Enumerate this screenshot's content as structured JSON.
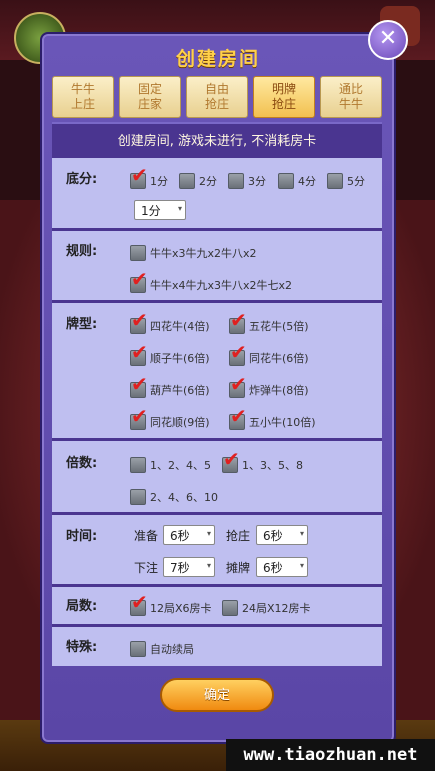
{
  "dialog": {
    "title": "创建房间",
    "close_icon": "close-icon",
    "tabs": [
      {
        "label": "牛牛\n上庄",
        "active": false
      },
      {
        "label": "固定\n庄家",
        "active": false
      },
      {
        "label": "自由\n抢庄",
        "active": false
      },
      {
        "label": "明牌\n抢庄",
        "active": true
      },
      {
        "label": "通比\n牛牛",
        "active": false
      }
    ],
    "notice": "创建房间, 游戏未进行, 不消耗房卡",
    "sections": {
      "base_score": {
        "label": "底分:",
        "options": [
          {
            "label": "1分",
            "checked": true
          },
          {
            "label": "2分",
            "checked": false
          },
          {
            "label": "3分",
            "checked": false
          },
          {
            "label": "4分",
            "checked": false
          },
          {
            "label": "5分",
            "checked": false
          }
        ],
        "select_value": "1分"
      },
      "rules": {
        "label": "规则:",
        "options": [
          {
            "label": "牛牛x3牛九x2牛八x2",
            "checked": false
          },
          {
            "label": "牛牛x4牛九x3牛八x2牛七x2",
            "checked": true
          }
        ]
      },
      "card_types": {
        "label": "牌型:",
        "options": [
          {
            "label": "四花牛(4倍)",
            "checked": true
          },
          {
            "label": "五花牛(5倍)",
            "checked": true
          },
          {
            "label": "顺子牛(6倍)",
            "checked": true
          },
          {
            "label": "同花牛(6倍)",
            "checked": true
          },
          {
            "label": "葫芦牛(6倍)",
            "checked": true
          },
          {
            "label": "炸弹牛(8倍)",
            "checked": true
          },
          {
            "label": "同花顺(9倍)",
            "checked": true
          },
          {
            "label": "五小牛(10倍)",
            "checked": true
          }
        ]
      },
      "multiplier": {
        "label": "倍数:",
        "options": [
          {
            "label": "1、2、4、5",
            "checked": false
          },
          {
            "label": "1、3、5、8",
            "checked": true
          },
          {
            "label": "2、4、6、10",
            "checked": false
          }
        ]
      },
      "time": {
        "label": "时间:",
        "fields": [
          {
            "label": "准备",
            "value": "6秒"
          },
          {
            "label": "抢庄",
            "value": "6秒"
          },
          {
            "label": "下注",
            "value": "7秒"
          },
          {
            "label": "摊牌",
            "value": "6秒"
          }
        ]
      },
      "rounds": {
        "label": "局数:",
        "options": [
          {
            "label": "12局X6房卡",
            "checked": true
          },
          {
            "label": "24局X12房卡",
            "checked": false
          }
        ]
      },
      "special": {
        "label": "特殊:",
        "options": [
          {
            "label": "自动续局",
            "checked": false
          }
        ]
      }
    },
    "confirm_label": "确定"
  },
  "watermark": "www.tiaozhuan.net"
}
